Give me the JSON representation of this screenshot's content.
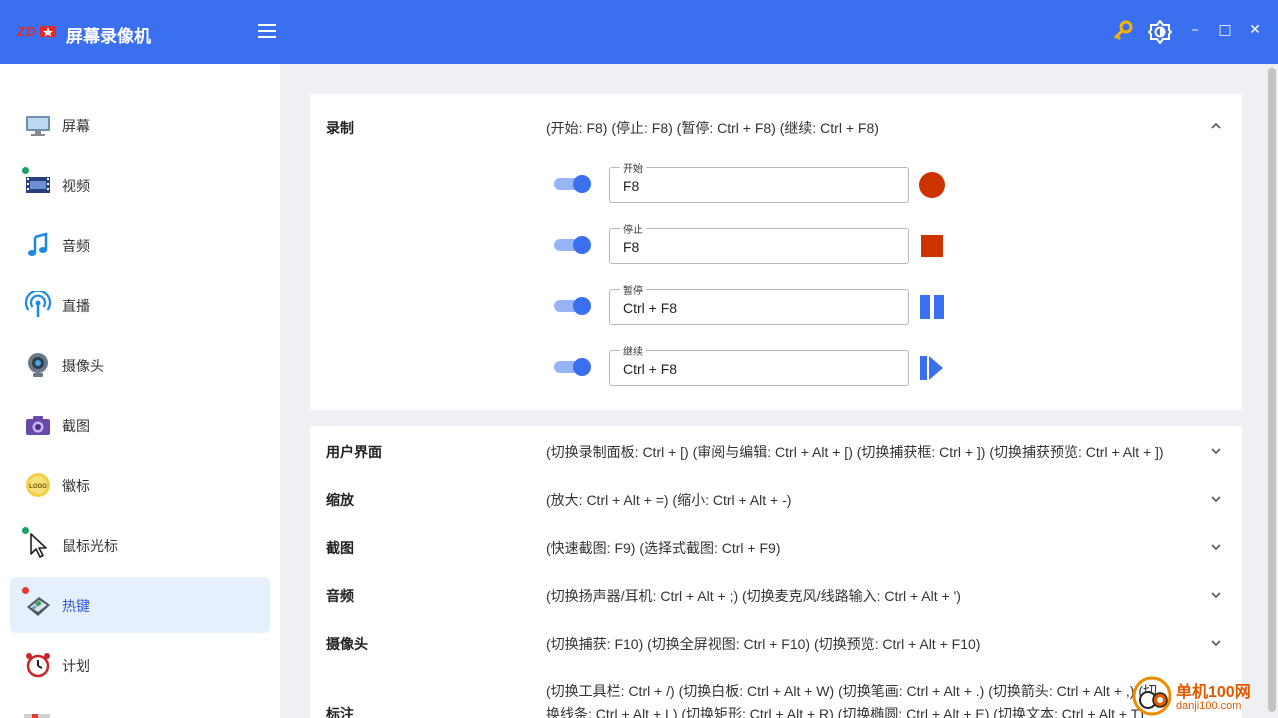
{
  "app": {
    "title": "屏幕录像机",
    "logo_text": "ZD"
  },
  "titlebar": {
    "menu_icon": "hamburger-icon",
    "key_icon": "key-icon",
    "theme_icon": "brightness-icon",
    "minimize": "–",
    "maximize": "□",
    "close": "✕"
  },
  "sidebar": {
    "items": [
      {
        "label": "屏幕",
        "icon": "monitor-icon"
      },
      {
        "label": "视频",
        "icon": "film-icon"
      },
      {
        "label": "音频",
        "icon": "music-note-icon"
      },
      {
        "label": "直播",
        "icon": "broadcast-icon"
      },
      {
        "label": "摄像头",
        "icon": "webcam-icon"
      },
      {
        "label": "截图",
        "icon": "camera-icon"
      },
      {
        "label": "徽标",
        "icon": "logo-badge-icon"
      },
      {
        "label": "鼠标光标",
        "icon": "cursor-icon"
      },
      {
        "label": "热键",
        "icon": "keyboard-icon",
        "active": true
      },
      {
        "label": "计划",
        "icon": "alarm-clock-icon"
      }
    ]
  },
  "hotkeys": {
    "record": {
      "title": "录制",
      "summary": "(开始: F8) (停止: F8) (暂停: Ctrl + F8) (继续: Ctrl + F8)",
      "items": [
        {
          "label": "开始",
          "value": "F8",
          "enabled": true,
          "action_icon": "record-icon"
        },
        {
          "label": "停止",
          "value": "F8",
          "enabled": true,
          "action_icon": "stop-icon"
        },
        {
          "label": "暂停",
          "value": "Ctrl + F8",
          "enabled": true,
          "action_icon": "pause-icon"
        },
        {
          "label": "继续",
          "value": "Ctrl + F8",
          "enabled": true,
          "action_icon": "resume-icon"
        }
      ]
    },
    "sections": [
      {
        "title": "用户界面",
        "summary": "(切换录制面板: Ctrl + [) (审阅与编辑: Ctrl + Alt + [) (切换捕获框: Ctrl + ]) (切换捕获预览: Ctrl + Alt + ])"
      },
      {
        "title": "缩放",
        "summary": "(放大: Ctrl + Alt + =) (缩小: Ctrl + Alt + -)"
      },
      {
        "title": "截图",
        "summary": "(快速截图: F9) (选择式截图: Ctrl + F9)"
      },
      {
        "title": "音频",
        "summary": "(切换扬声器/耳机: Ctrl + Alt + ;) (切换麦克风/线路输入: Ctrl + Alt + ')"
      },
      {
        "title": "摄像头",
        "summary": "(切换捕获: F10) (切换全屏视图: Ctrl + F10) (切换预览: Ctrl + Alt + F10)"
      },
      {
        "title": "标注",
        "summary_line1": "(切换工具栏: Ctrl + /) (切换白板: Ctrl + Alt + W) (切换笔画: Ctrl + Alt + .) (切换箭头: Ctrl + Alt + ,) (切",
        "summary_line2": "换线条: Ctrl + Alt + L) (切换矩形: Ctrl + Alt + R) (切换椭圆: Ctrl + Alt + E) (切换文本: Ctrl + Alt + T)"
      }
    ]
  },
  "colors": {
    "brand": "#3a6ff0",
    "record": "#cc3300",
    "pause": "#3a6ff0"
  },
  "watermark": {
    "text": "单机100网",
    "url": "danji100.com"
  }
}
